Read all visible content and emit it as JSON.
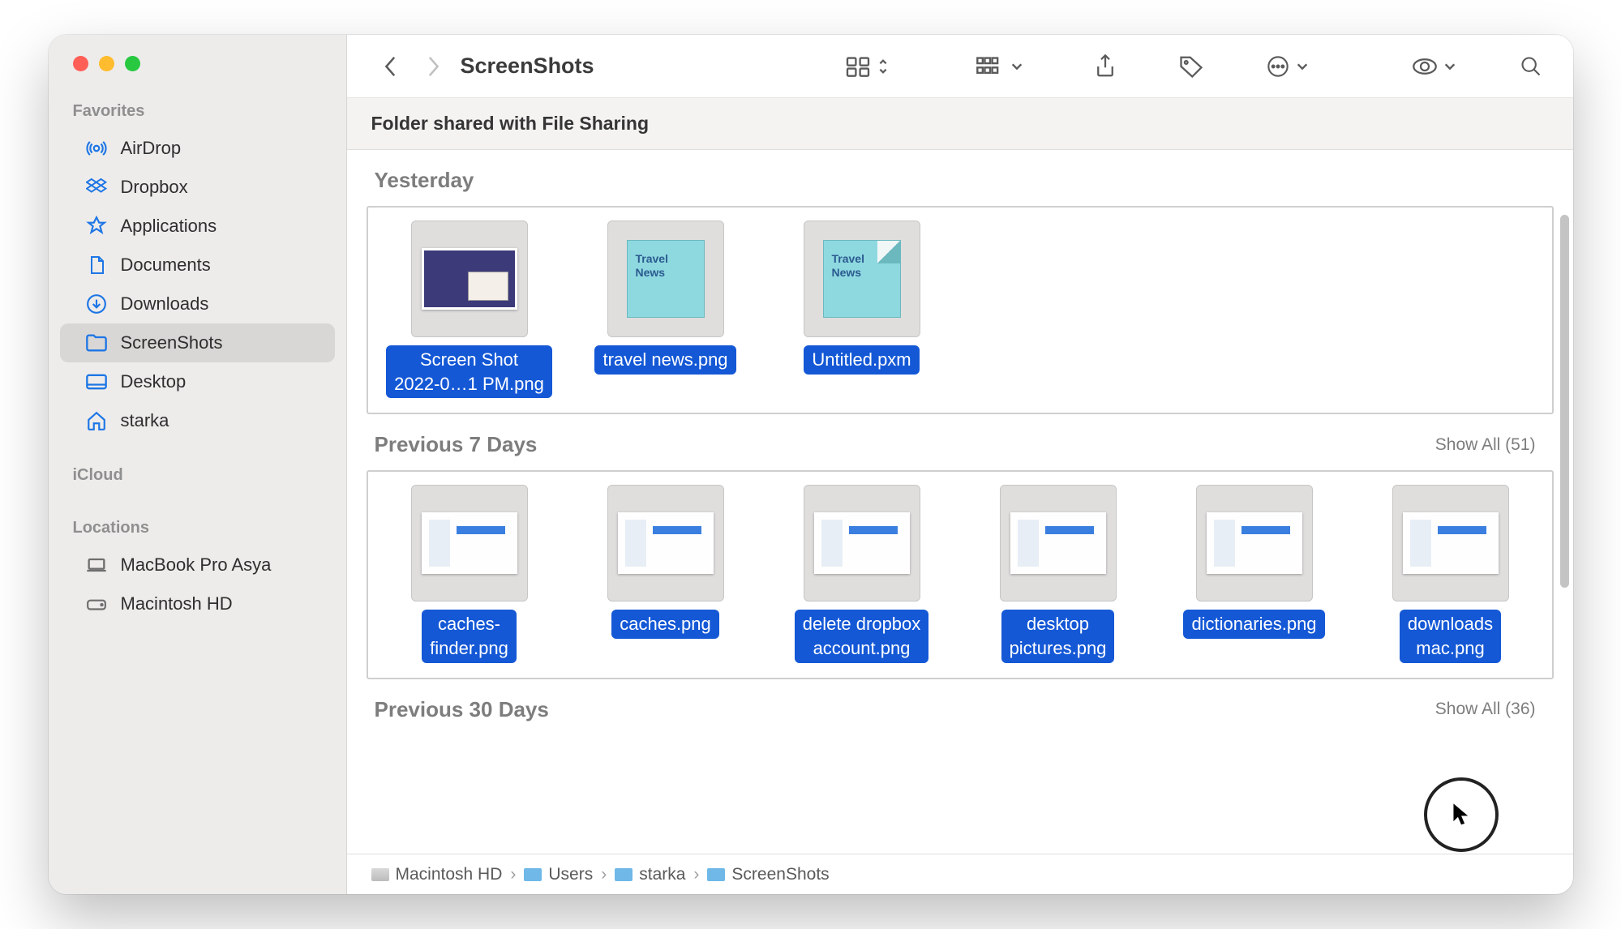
{
  "window": {
    "title": "ScreenShots",
    "banner": "Folder shared with File Sharing"
  },
  "sidebar": {
    "sections": {
      "favorites_label": "Favorites",
      "icloud_label": "iCloud",
      "locations_label": "Locations"
    },
    "favorites": [
      {
        "label": "AirDrop",
        "icon": "airdrop"
      },
      {
        "label": "Dropbox",
        "icon": "dropbox"
      },
      {
        "label": "Applications",
        "icon": "apps"
      },
      {
        "label": "Documents",
        "icon": "doc"
      },
      {
        "label": "Downloads",
        "icon": "download"
      },
      {
        "label": "ScreenShots",
        "icon": "folder",
        "active": true
      },
      {
        "label": "Desktop",
        "icon": "desktop"
      },
      {
        "label": "starka",
        "icon": "home"
      }
    ],
    "locations": [
      {
        "label": "MacBook Pro Asya",
        "icon": "laptop"
      },
      {
        "label": "Macintosh HD",
        "icon": "disk"
      }
    ]
  },
  "groups": [
    {
      "title": "Yesterday",
      "show_all": null,
      "items": [
        {
          "name_line1": "Screen Shot",
          "name_line2": "2022-0…1 PM.png",
          "thumb": "img"
        },
        {
          "name_line1": "travel news.png",
          "thumb": "note",
          "note": "Travel\nNews"
        },
        {
          "name_line1": "Untitled.pxm",
          "thumb": "note-fold",
          "note": "Travel\nNews"
        }
      ]
    },
    {
      "title": "Previous 7 Days",
      "show_all": "Show All (51)",
      "items": [
        {
          "name_line1": "caches-",
          "name_line2": "finder.png",
          "thumb": "shot"
        },
        {
          "name_line1": "caches.png",
          "thumb": "shot"
        },
        {
          "name_line1": "delete dropbox",
          "name_line2": "account.png",
          "thumb": "shot"
        },
        {
          "name_line1": "desktop",
          "name_line2": "pictures.png",
          "thumb": "shot"
        },
        {
          "name_line1": "dictionaries.png",
          "thumb": "shot"
        },
        {
          "name_line1": "downloads",
          "name_line2": "mac.png",
          "thumb": "shot"
        }
      ]
    },
    {
      "title": "Previous 30 Days",
      "show_all": "Show All (36)",
      "items": []
    }
  ],
  "pathbar": [
    "Macintosh HD",
    "Users",
    "starka",
    "ScreenShots"
  ]
}
